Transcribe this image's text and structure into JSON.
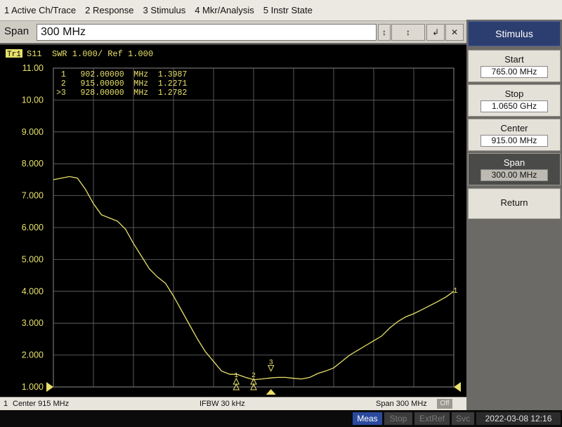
{
  "menu": {
    "items": [
      "1 Active Ch/Trace",
      "2 Response",
      "3 Stimulus",
      "4 Mkr/Analysis",
      "5 Instr State"
    ]
  },
  "entry": {
    "label": "Span",
    "value": "300 MHz",
    "buttons": [
      "↕",
      "↕",
      "↲",
      "✕"
    ]
  },
  "trace": {
    "tag": "Tr1",
    "header": "S11  SWR 1.000/ Ref 1.000",
    "markers": [
      {
        "line": " 1   902.00000  MHz  1.3987"
      },
      {
        "line": " 2   915.00000  MHz  1.2271"
      },
      {
        "line": ">3   928.00000  MHz  1.2782"
      }
    ]
  },
  "chart_data": {
    "type": "line",
    "title": "",
    "xlabel": "",
    "ylabel": "",
    "x_unit": "MHz",
    "xlim": [
      765,
      1065
    ],
    "ylim": [
      1,
      11
    ],
    "grid": true,
    "yticks": [
      "11.00",
      "10.00",
      "9.000",
      "8.000",
      "7.000",
      "6.000",
      "5.000",
      "4.000",
      "3.000",
      "2.000",
      "1.000"
    ],
    "series": [
      {
        "x": [
          765,
          771,
          777,
          783,
          789,
          795,
          801,
          807,
          813,
          819,
          825,
          831,
          837,
          843,
          849,
          855,
          861,
          867,
          873,
          879,
          885,
          891,
          897,
          903,
          909,
          915,
          921,
          927,
          933,
          939,
          945,
          951,
          957,
          963,
          969,
          975,
          981,
          987,
          993,
          999,
          1005,
          1011,
          1017,
          1023,
          1029,
          1035,
          1041,
          1047,
          1053,
          1059,
          1065
        ],
        "y": [
          7.5,
          7.55,
          7.6,
          7.55,
          7.2,
          6.75,
          6.4,
          6.3,
          6.2,
          5.95,
          5.5,
          5.1,
          4.7,
          4.45,
          4.25,
          3.85,
          3.4,
          2.95,
          2.5,
          2.1,
          1.8,
          1.5,
          1.4,
          1.39,
          1.3,
          1.23,
          1.25,
          1.28,
          1.3,
          1.3,
          1.27,
          1.25,
          1.3,
          1.42,
          1.5,
          1.6,
          1.8,
          2.0,
          2.15,
          2.3,
          2.45,
          2.6,
          2.85,
          3.05,
          3.2,
          3.3,
          3.42,
          3.55,
          3.68,
          3.82,
          4.0
        ],
        "color": "#e8e06a"
      }
    ],
    "markers": [
      {
        "id": "1",
        "x": 902,
        "y": 1.3987
      },
      {
        "id": "2",
        "x": 915,
        "y": 1.2271
      },
      {
        "id": "3",
        "x": 928,
        "y": 1.2782,
        "active": true
      }
    ],
    "ref_value": 1.0,
    "end_label": "1"
  },
  "status": {
    "channel": "1",
    "center": "Center 915 MHz",
    "ifbw": "IFBW 30 kHz",
    "span": "Span 300 MHz",
    "off": "Off"
  },
  "softkeys": {
    "title": "Stimulus",
    "items": [
      {
        "label": "Start",
        "value": "765.00 MHz"
      },
      {
        "label": "Stop",
        "value": "1.0650 GHz"
      },
      {
        "label": "Center",
        "value": "915.00 MHz"
      },
      {
        "label": "Span",
        "value": "300.00 MHz"
      }
    ],
    "return_label": "Return"
  },
  "system": {
    "meas": "Meas",
    "stop": "Stop",
    "extref": "ExtRef",
    "svc": "Svc",
    "datetime": "2022-03-08 12:16"
  }
}
